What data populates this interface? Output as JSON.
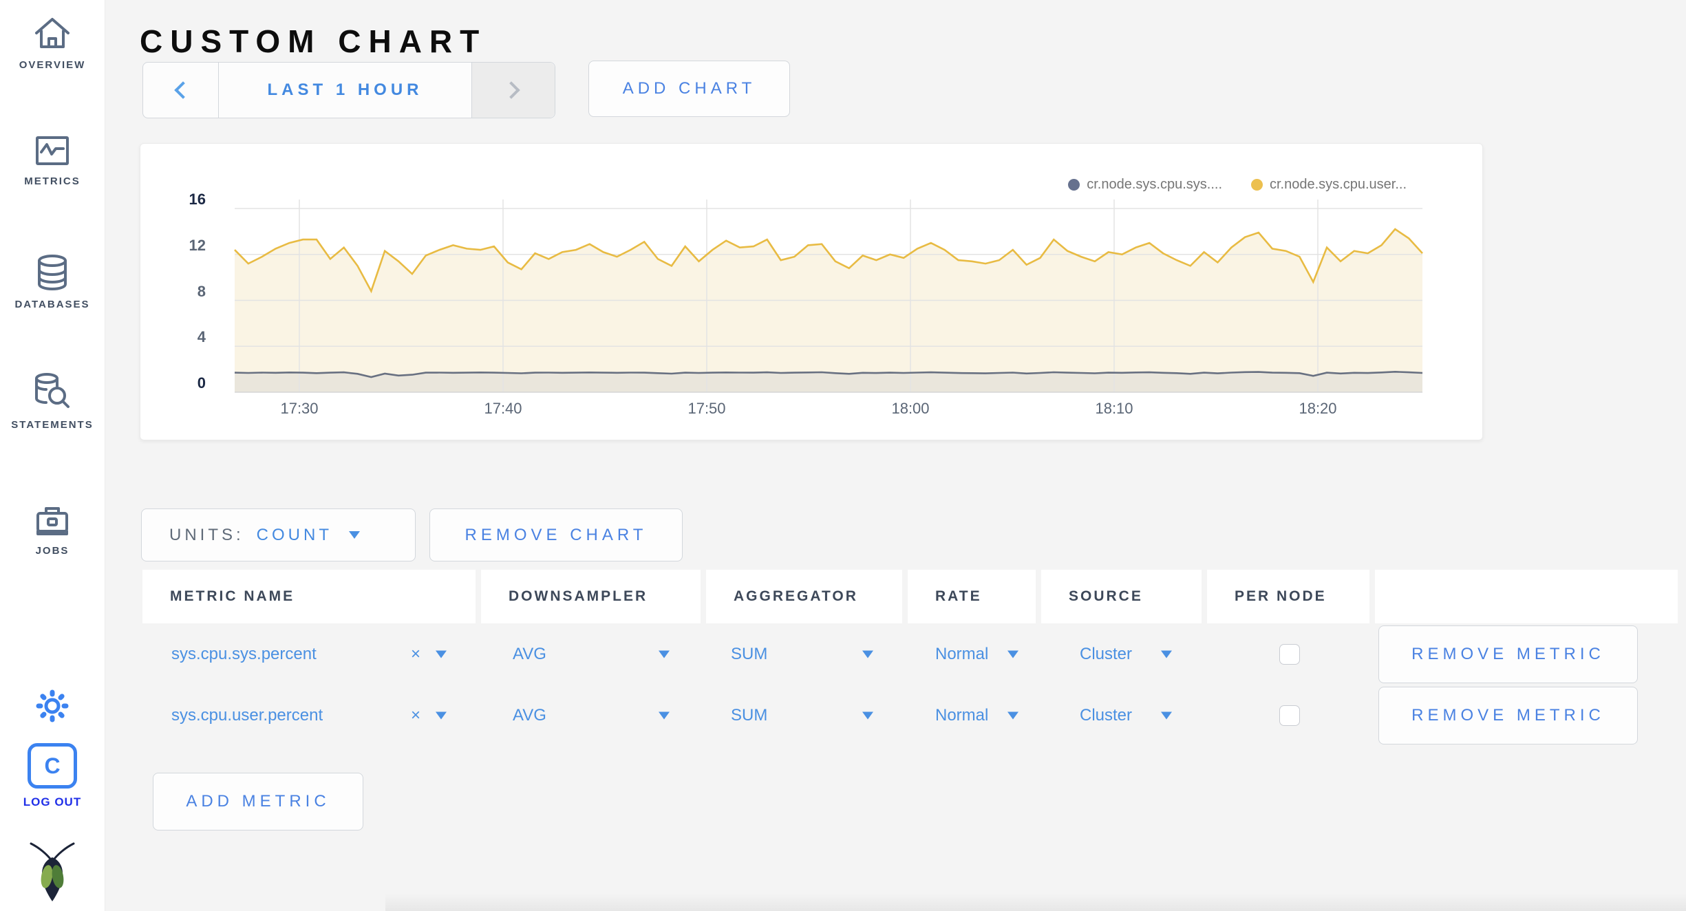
{
  "header": {
    "title": "CUSTOM CHART"
  },
  "sidebar": {
    "items": [
      {
        "label": "OVERVIEW",
        "icon": "home-icon"
      },
      {
        "label": "METRICS",
        "icon": "metrics-chart-icon"
      },
      {
        "label": "DATABASES",
        "icon": "database-icon"
      },
      {
        "label": "STATEMENTS",
        "icon": "statements-search-icon"
      },
      {
        "label": "JOBS",
        "icon": "briefcase-icon"
      }
    ],
    "gear_icon": "gear-icon",
    "log_out_label": "LOG OUT",
    "logo_icon": "cockroach-bug-icon",
    "accent_blue": "#3b82f0",
    "logout_blue": "#2130e8"
  },
  "toolbar": {
    "prev_label": "previous time range",
    "time_range": "LAST 1 HOUR",
    "next_label": "next time range",
    "add_chart": "ADD CHART"
  },
  "chart": {
    "legend": [
      {
        "label": "cr.node.sys.cpu.sys....",
        "color": "#66718e"
      },
      {
        "label": "cr.node.sys.cpu.user...",
        "color": "#ecc04f"
      }
    ]
  },
  "chart_data": {
    "type": "line",
    "title": "",
    "xlabel": "",
    "ylabel": "",
    "ylim": [
      0,
      16
    ],
    "y_ticks": [
      16,
      12,
      8,
      4,
      0
    ],
    "x_ticks": [
      "17:30",
      "17:40",
      "17:50",
      "18:00",
      "18:10",
      "18:20"
    ],
    "grid": true,
    "legend_position": "top-right",
    "series": [
      {
        "name": "cr.node.sys.cpu.sys....",
        "color": "#687081",
        "fill": "#eae6dc",
        "values": [
          1.7,
          1.68,
          1.71,
          1.69,
          1.72,
          1.7,
          1.66,
          1.7,
          1.73,
          1.6,
          1.32,
          1.62,
          1.45,
          1.52,
          1.7,
          1.71,
          1.69,
          1.7,
          1.72,
          1.7,
          1.68,
          1.65,
          1.7,
          1.71,
          1.69,
          1.7,
          1.72,
          1.7,
          1.69,
          1.71,
          1.7,
          1.66,
          1.62,
          1.7,
          1.68,
          1.7,
          1.72,
          1.71,
          1.7,
          1.73,
          1.68,
          1.7,
          1.72,
          1.74,
          1.66,
          1.6,
          1.69,
          1.67,
          1.7,
          1.68,
          1.71,
          1.73,
          1.7,
          1.67,
          1.66,
          1.64,
          1.68,
          1.71,
          1.63,
          1.68,
          1.74,
          1.7,
          1.68,
          1.65,
          1.7,
          1.69,
          1.72,
          1.73,
          1.69,
          1.66,
          1.6,
          1.7,
          1.64,
          1.71,
          1.75,
          1.76,
          1.7,
          1.69,
          1.66,
          1.42,
          1.7,
          1.63,
          1.69,
          1.67,
          1.72,
          1.78,
          1.73,
          1.68
        ]
      },
      {
        "name": "cr.node.sys.cpu.user...",
        "color": "#e8bb43",
        "fill": "#faf4e4",
        "values": [
          12.4,
          11.2,
          11.8,
          12.5,
          13.0,
          13.3,
          13.3,
          11.6,
          12.6,
          11.0,
          8.8,
          12.3,
          11.4,
          10.3,
          11.9,
          12.4,
          12.8,
          12.5,
          12.4,
          12.7,
          11.3,
          10.7,
          12.1,
          11.6,
          12.2,
          12.4,
          12.9,
          12.2,
          11.8,
          12.4,
          13.1,
          11.6,
          11.0,
          12.7,
          11.4,
          12.4,
          13.2,
          12.6,
          12.7,
          13.3,
          11.5,
          11.8,
          12.8,
          12.9,
          11.4,
          10.8,
          11.9,
          11.5,
          12.0,
          11.7,
          12.5,
          13.0,
          12.4,
          11.5,
          11.4,
          11.2,
          11.5,
          12.4,
          11.1,
          11.7,
          13.3,
          12.3,
          11.8,
          11.4,
          12.2,
          12.0,
          12.6,
          13.0,
          12.1,
          11.5,
          11.0,
          12.2,
          11.3,
          12.6,
          13.5,
          13.9,
          12.5,
          12.3,
          11.8,
          9.6,
          12.6,
          11.4,
          12.3,
          12.1,
          12.8,
          14.2,
          13.4,
          12.1
        ]
      }
    ]
  },
  "units": {
    "label": "UNITS:",
    "value": "COUNT"
  },
  "remove_chart_label": "REMOVE CHART",
  "table": {
    "headers": [
      "METRIC NAME",
      "DOWNSAMPLER",
      "AGGREGATOR",
      "RATE",
      "SOURCE",
      "PER NODE"
    ],
    "rows": [
      {
        "metric": "sys.cpu.sys.percent",
        "downsampler": "AVG",
        "aggregator": "SUM",
        "rate": "Normal",
        "source": "Cluster",
        "per_node_checked": false,
        "remove_label": "REMOVE METRIC"
      },
      {
        "metric": "sys.cpu.user.percent",
        "downsampler": "AVG",
        "aggregator": "SUM",
        "rate": "Normal",
        "source": "Cluster",
        "per_node_checked": false,
        "remove_label": "REMOVE METRIC"
      }
    ]
  },
  "add_metric_label": "ADD METRIC",
  "colors": {
    "accent_blue": "#4a90e2",
    "button_blue": "#4a82e2",
    "page_bg": "#f4f4f4",
    "card_bg": "#ffffff"
  }
}
